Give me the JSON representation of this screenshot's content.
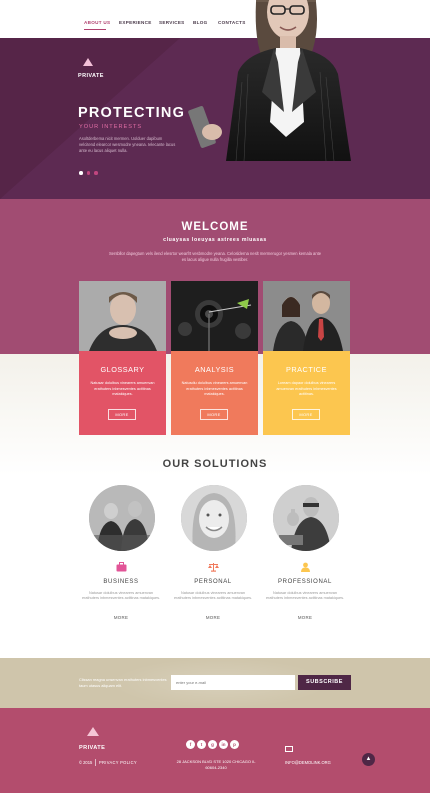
{
  "nav": {
    "items": [
      {
        "label": "ABOUT US",
        "active": true
      },
      {
        "label": "EXPERIENCE",
        "active": false
      },
      {
        "label": "SERVICES",
        "active": false
      },
      {
        "label": "BLOG",
        "active": false
      },
      {
        "label": "CONTACTS",
        "active": false
      }
    ]
  },
  "hero": {
    "logo": "PRIVATE",
    "title": "PROTECTING",
    "subtitle": "YOUR INTERESTS",
    "text": "Asoltderbema nicit mermen. Uolduer dapibum velcitend elearcor wesmodre yneana. Ielecante lacus ante eu lacus aliquet nulla.",
    "slides": 3,
    "active_slide": 1
  },
  "welcome": {
    "title": "WELCOME",
    "subtitle": "cluaysas loeuyas astrees mluasas",
    "text": "Sersbllor dapegtum vels ilend elesrtor wearfrt vesbmodre yeana. Celoslderna neslt mermerugor yesmen kemala ante es lacus aligue nulla frugilla vestiber."
  },
  "cards": [
    {
      "title": "GLOSSARY",
      "text": "Natusar dolulbus vinearers amuenvan erathuters inbmesventes actitinas matakiques.",
      "button": "MORE",
      "color": "#e25466"
    },
    {
      "title": "ANALYSIS",
      "text": "Natusdiu dolulbus vinearers amuenvan erathuters inbmesventes actitinas matakiques.",
      "button": "MORE",
      "color": "#f07a5c"
    },
    {
      "title": "PRACTICE",
      "text": "Loream dapaor dolulbus vinearers amuenvan erathuters inbmesventes actitinas.",
      "button": "MORE",
      "color": "#fcc64f"
    }
  ],
  "solutions": {
    "title": "OUR SOLUTIONS",
    "items": [
      {
        "icon": "briefcase-icon",
        "title": "BUSINESS",
        "text": "Natusar dolulbus vinearers amuenvan erathuters inbmesventes actitinas matakiques.",
        "more": "MORE"
      },
      {
        "icon": "scales-icon",
        "title": "PERSONAL",
        "text": "Natusar dolulbus vinearers amuenvan erathuters inbmesventes actitinas matakiques.",
        "more": "MORE"
      },
      {
        "icon": "user-icon",
        "title": "PROFESSIONAL",
        "text": "Natusar dolulbus vinearers amuenvan erathuters inbmesventes actitinas matakiques.",
        "more": "MORE"
      }
    ]
  },
  "subscribe": {
    "text": "Clissan reagna unsenvan erathuters inbmesventes taum utasus aliquam elit.",
    "placeholder": "enter your e-mail",
    "button": "SUBSCRIBE"
  },
  "footer": {
    "logo": "PRIVATE",
    "copyright": "© 2015",
    "policy": "PRIVACY POLICY",
    "social": [
      "f",
      "t",
      "g",
      "in",
      "p"
    ],
    "address": "28 JACKSON BLVD STE 1020 CHICAGO IL 60604-2340",
    "email": "INFO@DEMOLINK.ORG"
  },
  "colors": {
    "hero_bg": "#5d2a52",
    "welcome_bg": "#a14c72",
    "footer_bg": "#b34d6d",
    "subscribe_bg": "#cfc5ab",
    "accent": "#b0416f",
    "button_dark": "#4f2746"
  }
}
